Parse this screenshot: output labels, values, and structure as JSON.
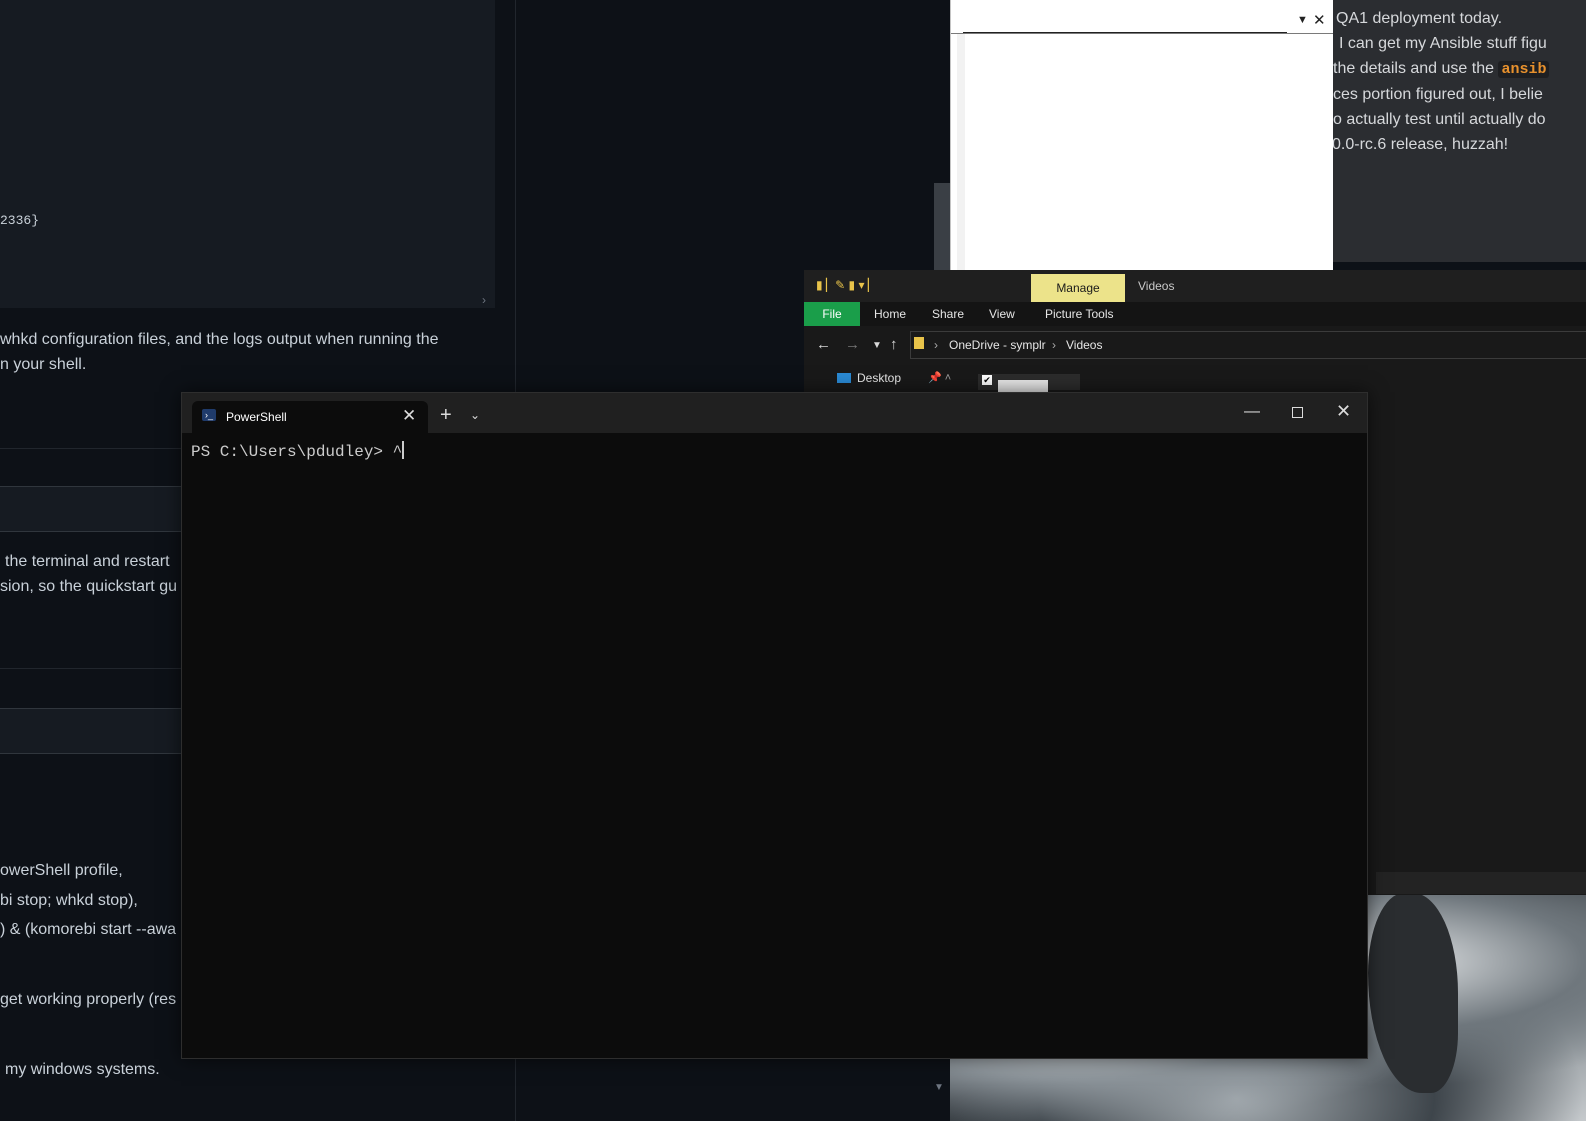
{
  "browser": {
    "code_line": "2336}",
    "para1_line1": "whkd configuration files, and the logs output when running the",
    "para1_line2": "n your shell.",
    "para2_line1": "the terminal and restart",
    "para2_line2": "sion, so the quickstart gu",
    "list_line1": "owerShell profile,",
    "list_line2": "bi stop; whkd stop),",
    "list_line3": ") & (komorebi start --awa",
    "para3": "get working properly (res",
    "para4": "my windows systems."
  },
  "chat": {
    "line1": "QA1 deployment today.",
    "line2": "I can get my Ansible stuff figu",
    "line3_pre": "the details and use the ",
    "line3_code": "ansib",
    "line4": "ces portion figured out, I belie",
    "line5": "o actually test until actually do",
    "line6": "0.0-rc.6 release, huzzah!"
  },
  "explorer": {
    "manage_label": "Manage",
    "title": "Videos",
    "ribbon_tabs": [
      "File",
      "Home",
      "Share",
      "View",
      "Picture Tools"
    ],
    "breadcrumb": [
      "OneDrive - symplr",
      "Videos"
    ],
    "nav_item": "Desktop"
  },
  "terminal": {
    "tab_title": "PowerShell",
    "prompt": "PS C:\\Users\\pdudley> ^"
  }
}
